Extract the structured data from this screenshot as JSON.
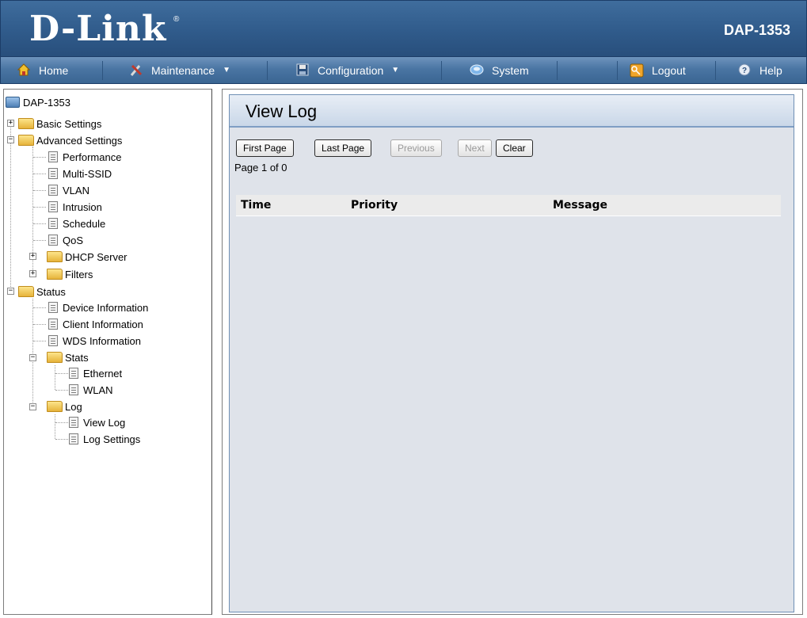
{
  "header": {
    "logo": "D-Link",
    "logo_mark": "®",
    "model": "DAP-1353"
  },
  "menu": {
    "home": "Home",
    "maintenance": "Maintenance",
    "configuration": "Configuration",
    "system": "System",
    "logout": "Logout",
    "help": "Help",
    "dropdown_caret": "▼"
  },
  "tree": {
    "root": "DAP-1353",
    "basic_settings": "Basic Settings",
    "advanced_settings": "Advanced Settings",
    "performance": "Performance",
    "multi_ssid": "Multi-SSID",
    "vlan": "VLAN",
    "intrusion": "Intrusion",
    "schedule": "Schedule",
    "qos": "QoS",
    "dhcp_server": "DHCP Server",
    "filters": "Filters",
    "status": "Status",
    "device_information": "Device Information",
    "client_information": "Client Information",
    "wds_information": "WDS Information",
    "stats": "Stats",
    "ethernet": "Ethernet",
    "wlan": "WLAN",
    "log": "Log",
    "view_log": "View Log",
    "log_settings": "Log Settings",
    "expand_symbol": "+",
    "collapse_symbol": "−"
  },
  "panel": {
    "title": "View Log",
    "buttons": {
      "first_page": "First Page",
      "last_page": "Last Page",
      "previous": "Previous",
      "next": "Next",
      "clear": "Clear"
    },
    "page_info": "Page 1 of 0",
    "columns": {
      "time": "Time",
      "priority": "Priority",
      "message": "Message"
    }
  },
  "colors": {
    "header_bg": "#305b8b",
    "menubar_bg": "#4a75a3",
    "panel_bg": "#dfe3ea",
    "panel_border": "#6f8fb5",
    "table_header_bg": "#ebebeb"
  },
  "icons": {
    "home": "home-icon",
    "maintenance": "tools-icon",
    "configuration": "floppy-disk-icon",
    "system": "system-icon",
    "logout": "key-icon",
    "help": "help-icon"
  }
}
